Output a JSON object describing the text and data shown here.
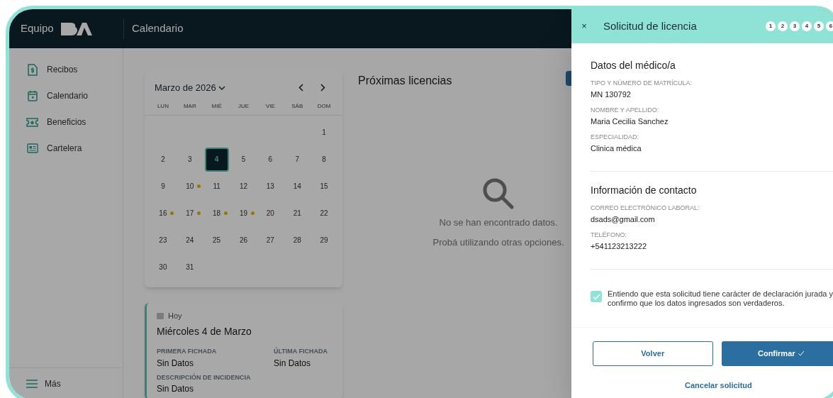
{
  "header": {
    "brand": "Equipo",
    "title": "Calendario"
  },
  "sidebar": {
    "items": [
      {
        "label": "Recibos"
      },
      {
        "label": "Calendario"
      },
      {
        "label": "Beneficios"
      },
      {
        "label": "Cartelera"
      }
    ],
    "more": "Más"
  },
  "calendar": {
    "month": "Marzo de 2026",
    "weekdays": [
      "LUN",
      "MAR",
      "MIÉ",
      "JUE",
      "VIE",
      "SÁB",
      "DOM"
    ],
    "days": [
      {
        "label": "1",
        "selected": false,
        "marked": false
      },
      {
        "label": "2",
        "selected": false,
        "marked": false
      },
      {
        "label": "3",
        "selected": false,
        "marked": false
      },
      {
        "label": "4",
        "selected": true,
        "marked": false
      },
      {
        "label": "5",
        "selected": false,
        "marked": false
      },
      {
        "label": "6",
        "selected": false,
        "marked": false
      },
      {
        "label": "7",
        "selected": false,
        "marked": false
      },
      {
        "label": "8",
        "selected": false,
        "marked": false
      },
      {
        "label": "9",
        "selected": false,
        "marked": false
      },
      {
        "label": "10",
        "selected": false,
        "marked": true
      },
      {
        "label": "11",
        "selected": false,
        "marked": false
      },
      {
        "label": "12",
        "selected": false,
        "marked": false
      },
      {
        "label": "13",
        "selected": false,
        "marked": false
      },
      {
        "label": "14",
        "selected": false,
        "marked": false
      },
      {
        "label": "15",
        "selected": false,
        "marked": false
      },
      {
        "label": "16",
        "selected": false,
        "marked": true
      },
      {
        "label": "17",
        "selected": false,
        "marked": true
      },
      {
        "label": "18",
        "selected": false,
        "marked": true
      },
      {
        "label": "19",
        "selected": false,
        "marked": true
      },
      {
        "label": "20",
        "selected": false,
        "marked": false
      },
      {
        "label": "21",
        "selected": false,
        "marked": false
      },
      {
        "label": "22",
        "selected": false,
        "marked": false
      },
      {
        "label": "23",
        "selected": false,
        "marked": false
      },
      {
        "label": "24",
        "selected": false,
        "marked": false
      },
      {
        "label": "25",
        "selected": false,
        "marked": false
      },
      {
        "label": "26",
        "selected": false,
        "marked": false
      },
      {
        "label": "27",
        "selected": false,
        "marked": false
      },
      {
        "label": "28",
        "selected": false,
        "marked": false
      },
      {
        "label": "29",
        "selected": false,
        "marked": false
      },
      {
        "label": "30",
        "selected": false,
        "marked": false
      },
      {
        "label": "31",
        "selected": false,
        "marked": false
      }
    ]
  },
  "today_card": {
    "badge": "Hoy",
    "date": "Miércoles 4 de Marzo",
    "fields": [
      {
        "label": "PRIMERA FICHADA",
        "value": "Sin Datos"
      },
      {
        "label": "ÚLTIMA FICHADA",
        "value": "Sin Datos"
      },
      {
        "label": "DESCRIPCIÓN DE INCIDENCIA",
        "value": "Sin Datos"
      }
    ]
  },
  "upcoming": {
    "title": "Próximas licencias",
    "empty_title": "No se han encontrado datos.",
    "empty_hint": "Probá utilizando otras opciones."
  },
  "drawer": {
    "close": "×",
    "title": "Solicitud de licencia",
    "steps": [
      "1",
      "2",
      "3",
      "4",
      "5",
      "6"
    ],
    "sections": [
      {
        "title": "Datos del médico/a",
        "fields": [
          {
            "label": "TIPO Y NÚMERO DE MATRÍCULA:",
            "value": "MN 130792"
          },
          {
            "label": "NOMBRE Y APELLIDO:",
            "value": "Maria Cecilia Sanchez"
          },
          {
            "label": "ESPECIALIDAD:",
            "value": "Clinica médica"
          }
        ]
      },
      {
        "title": "Información de contacto",
        "fields": [
          {
            "label": "CORREO ELECTRÓNICO LABORAL:",
            "value": "dsads@gmail.com"
          },
          {
            "label": "TELÉFONO:",
            "value": "+541123213222"
          }
        ]
      }
    ],
    "consent": {
      "checked": true,
      "text": "Entiendo que esta solicitud tiene carácter de declaración jurada y confirmo que los datos ingresados son verdaderos."
    },
    "back": "Volver",
    "confirm": "Confirmar",
    "cancel": "Cancelar solicitud"
  }
}
